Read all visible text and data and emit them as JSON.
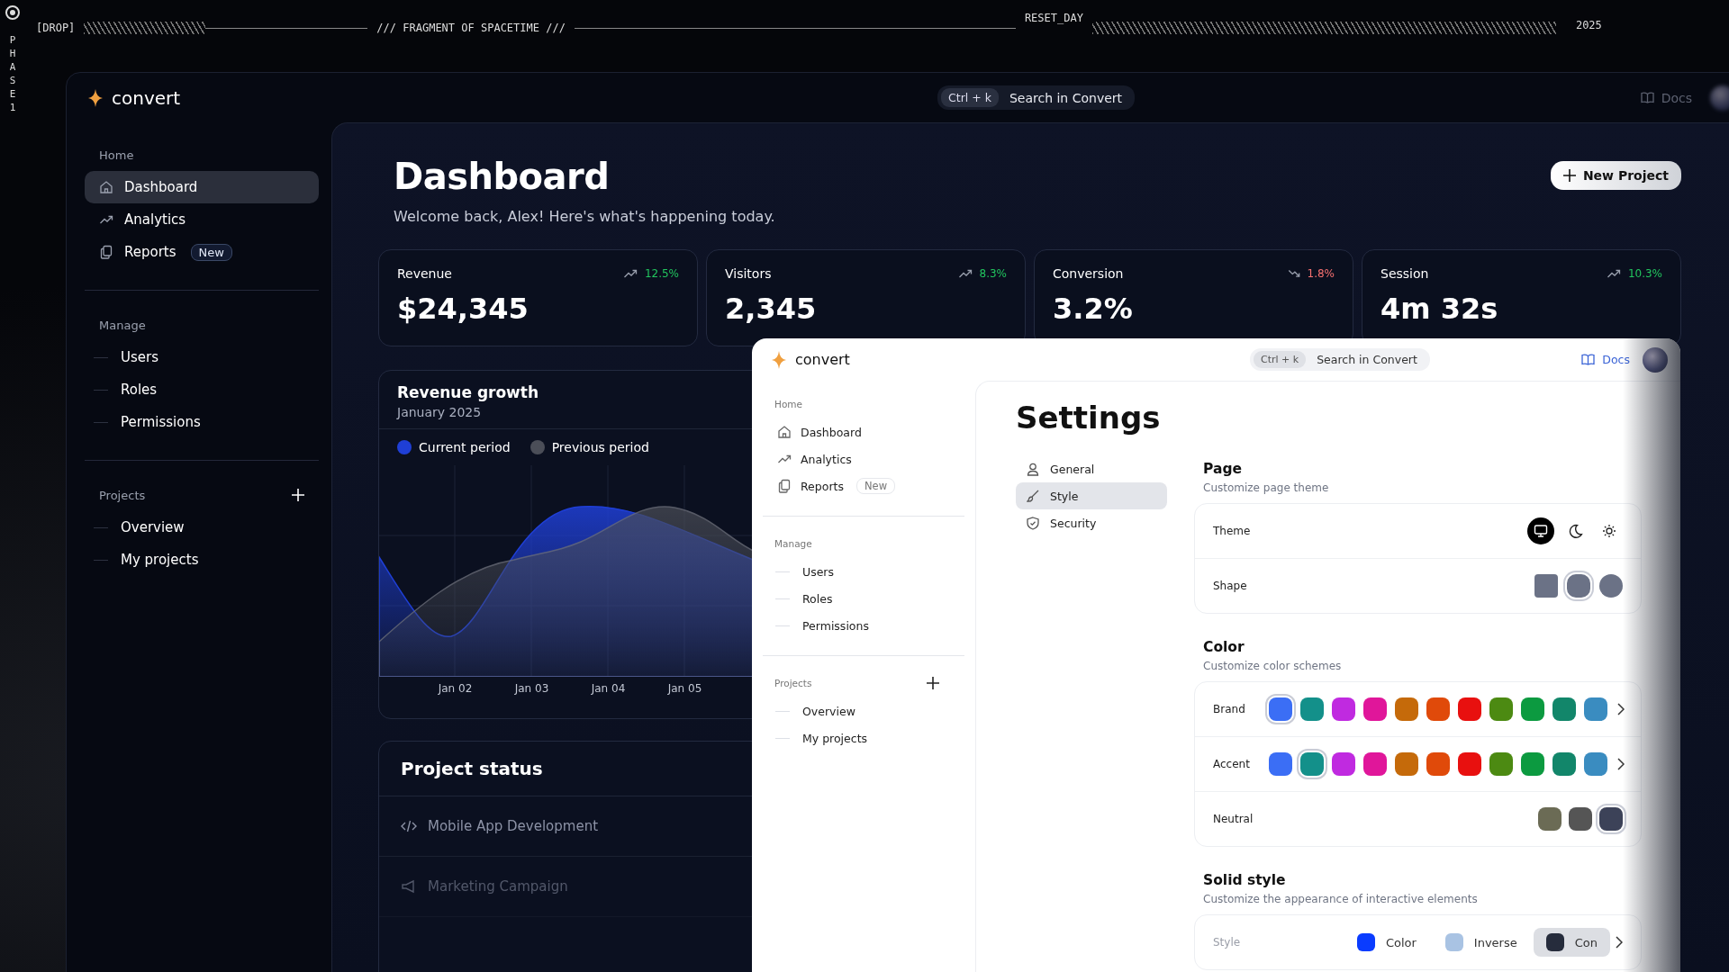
{
  "hud": {
    "side_letters": [
      "P",
      "H",
      "A",
      "S",
      "E",
      "1"
    ],
    "drop_tag": "[DROP]",
    "title": "/// FRAGMENT OF SPACETIME ///",
    "reset_label": "RESET_DAY",
    "year": "2025"
  },
  "dashboard_window": {
    "brand": "convert",
    "search": {
      "shortcut": "Ctrl + k",
      "placeholder": "Search in Convert"
    },
    "docs": "Docs",
    "sidebar": [
      {
        "label": "Home",
        "kind": "icons",
        "items": [
          {
            "label": "Dashboard",
            "selected": true
          },
          {
            "label": "Analytics",
            "selected": false
          },
          {
            "label": "Reports",
            "badge": "New",
            "selected": false
          }
        ]
      },
      {
        "label": "Manage",
        "kind": "tree",
        "items": [
          {
            "label": "Users",
            "selected": false
          },
          {
            "label": "Roles",
            "selected": false
          },
          {
            "label": "Permissions",
            "selected": false
          }
        ]
      },
      {
        "label": "Projects",
        "kind": "tree_add",
        "items": [
          {
            "label": "Overview",
            "selected": false
          },
          {
            "label": "My projects",
            "selected": false
          }
        ]
      }
    ],
    "title": "Dashboard",
    "welcome": "Welcome back, Alex! Here's what's happening today.",
    "new_project_button": "New Project",
    "stats": [
      {
        "label": "Revenue",
        "change": "12.5%",
        "falling": false,
        "value": "$24,345"
      },
      {
        "label": "Visitors",
        "change": "8.3%",
        "falling": false,
        "value": "2,345"
      },
      {
        "label": "Conversion",
        "change": "1.8%",
        "falling": true,
        "value": "3.2%"
      },
      {
        "label": "Session",
        "change": "10.3%",
        "falling": false,
        "value": "4m 32s"
      }
    ],
    "revenue_chart": {
      "title": "Revenue growth",
      "subtitle": "January 2025",
      "legend": [
        {
          "label": "Current period",
          "color": "#1f3fd6"
        },
        {
          "label": "Previous period",
          "color": "#4b4e58"
        }
      ],
      "x_labels": [
        "Jan 02",
        "Jan 03",
        "Jan 04",
        "Jan 05"
      ]
    },
    "project_status": {
      "title": "Project status",
      "items": [
        {
          "label": "Mobile App Development"
        },
        {
          "label": "Marketing Campaign"
        }
      ]
    }
  },
  "settings_window": {
    "brand": "convert",
    "search": {
      "shortcut": "Ctrl + k",
      "placeholder": "Search in Convert"
    },
    "docs": "Docs",
    "sidebar": [
      {
        "label": "Home",
        "kind": "icons",
        "items": [
          {
            "label": "Dashboard",
            "selected": false
          },
          {
            "label": "Analytics",
            "selected": false
          },
          {
            "label": "Reports",
            "badge": "New",
            "selected": false
          }
        ]
      },
      {
        "label": "Manage",
        "kind": "tree",
        "items": [
          {
            "label": "Users",
            "selected": false
          },
          {
            "label": "Roles",
            "selected": false
          },
          {
            "label": "Permissions",
            "selected": false
          }
        ]
      },
      {
        "label": "Projects",
        "kind": "tree_add",
        "items": [
          {
            "label": "Overview",
            "selected": false
          },
          {
            "label": "My projects",
            "selected": false
          }
        ]
      }
    ],
    "title": "Settings",
    "tabs": [
      {
        "label": "General",
        "selected": false
      },
      {
        "label": "Style",
        "selected": true
      },
      {
        "label": "Security",
        "selected": false
      }
    ],
    "sections": [
      {
        "title": "Page",
        "subtitle": "Customize page theme",
        "rows": [
          {
            "label": "Theme",
            "kind": "theme",
            "options": [
              {
                "selected": true
              },
              {
                "selected": false
              },
              {
                "selected": false
              }
            ]
          },
          {
            "label": "Shape",
            "kind": "shape",
            "options": [
              {
                "selected": false
              },
              {
                "selected": true
              },
              {
                "selected": false
              }
            ]
          }
        ]
      },
      {
        "title": "Color",
        "subtitle": "Customize color schemes",
        "rows": [
          {
            "label": "Brand",
            "kind": "swatches",
            "more": true,
            "swatches": [
              {
                "color": "#3b6ef5",
                "selected": true
              },
              {
                "color": "#13908a",
                "selected": false
              },
              {
                "color": "#c02ae0",
                "selected": false
              },
              {
                "color": "#e0169a",
                "selected": false
              },
              {
                "color": "#c56a0a",
                "selected": false
              },
              {
                "color": "#e04a0a",
                "selected": false
              },
              {
                "color": "#e8100f",
                "selected": false
              },
              {
                "color": "#4c8a12",
                "selected": false
              },
              {
                "color": "#0c9a40",
                "selected": false
              },
              {
                "color": "#12866a",
                "selected": false
              },
              {
                "color": "#3a8cc0",
                "selected": false
              }
            ]
          },
          {
            "label": "Accent",
            "kind": "swatches",
            "more": true,
            "swatches": [
              {
                "color": "#3b6ef5",
                "selected": false
              },
              {
                "color": "#13908a",
                "selected": true
              },
              {
                "color": "#c02ae0",
                "selected": false
              },
              {
                "color": "#e0169a",
                "selected": false
              },
              {
                "color": "#c56a0a",
                "selected": false
              },
              {
                "color": "#e04a0a",
                "selected": false
              },
              {
                "color": "#e8100f",
                "selected": false
              },
              {
                "color": "#4c8a12",
                "selected": false
              },
              {
                "color": "#0c9a40",
                "selected": false
              },
              {
                "color": "#12866a",
                "selected": false
              },
              {
                "color": "#3a8cc0",
                "selected": false
              }
            ]
          },
          {
            "label": "Neutral",
            "kind": "swatches",
            "more": false,
            "swatches": [
              {
                "color": "#6b6b55",
                "selected": false
              },
              {
                "color": "#555555",
                "selected": false
              },
              {
                "color": "#3c4258",
                "selected": true
              }
            ]
          }
        ]
      },
      {
        "title": "Solid style",
        "subtitle": "Customize the appearance of interactive elements",
        "rows": [
          {
            "label": "Style",
            "kind": "styles",
            "more": true,
            "options": [
              {
                "label": "Color",
                "color": "#0a3cff",
                "selected": false
              },
              {
                "label": "Inverse",
                "color": "#a9c3e3",
                "selected": false
              },
              {
                "label": "Con",
                "color": "#262c3c",
                "selected": true
              }
            ]
          }
        ]
      }
    ]
  }
}
